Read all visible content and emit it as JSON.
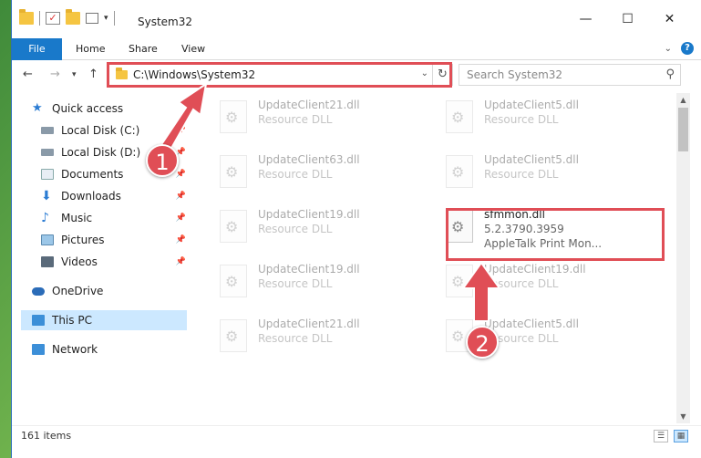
{
  "window": {
    "title": "System32",
    "minimize": "—",
    "maximize": "☐",
    "close": "✕"
  },
  "ribbon": {
    "file": "File",
    "home": "Home",
    "share": "Share",
    "view": "View",
    "help": "?"
  },
  "address": {
    "path": "C:\\Windows\\System32",
    "search_placeholder": "Search System32"
  },
  "nav": {
    "back": "←",
    "forward": "→",
    "up": "↑",
    "items": [
      {
        "label": "Quick access",
        "icon": "star-icon"
      },
      {
        "label": "Local Disk (C:)",
        "icon": "drive-icon"
      },
      {
        "label": "Local Disk (D:)",
        "icon": "drive-icon"
      },
      {
        "label": "Documents",
        "icon": "documents-icon"
      },
      {
        "label": "Downloads",
        "icon": "downloads-icon"
      },
      {
        "label": "Music",
        "icon": "music-icon"
      },
      {
        "label": "Pictures",
        "icon": "pictures-icon"
      },
      {
        "label": "Videos",
        "icon": "videos-icon"
      },
      {
        "label": "OneDrive",
        "icon": "cloud-icon"
      },
      {
        "label": "This PC",
        "icon": "computer-icon"
      },
      {
        "label": "Network",
        "icon": "network-icon"
      }
    ]
  },
  "files": [
    {
      "name": "UpdateClient21.dll",
      "type": "Resource DLL"
    },
    {
      "name": "UpdateClient5.dll",
      "type": "Resource DLL"
    },
    {
      "name": "UpdateClient63.dll",
      "type": "Resource DLL"
    },
    {
      "name": "UpdateClient5.dll",
      "type": "Resource DLL"
    },
    {
      "name": "UpdateClient19.dll",
      "type": "Resource DLL"
    },
    {
      "name": "sfmmon.dll",
      "version": "5.2.3790.3959",
      "description": "AppleTalk Print Mon..."
    },
    {
      "name": "UpdateClient19.dll",
      "type": "Resource DLL"
    },
    {
      "name": "UpdateClient19.dll",
      "type": "Resource DLL"
    },
    {
      "name": "UpdateClient21.dll",
      "type": "Resource DLL"
    },
    {
      "name": "UpdateClient5.dll",
      "type": "Resource DLL"
    }
  ],
  "status": {
    "count": "161 items"
  },
  "callouts": {
    "one": "1",
    "two": "2"
  },
  "colors": {
    "accent": "#1979ca",
    "highlight": "#e04e56",
    "selected": "#cce8ff"
  }
}
